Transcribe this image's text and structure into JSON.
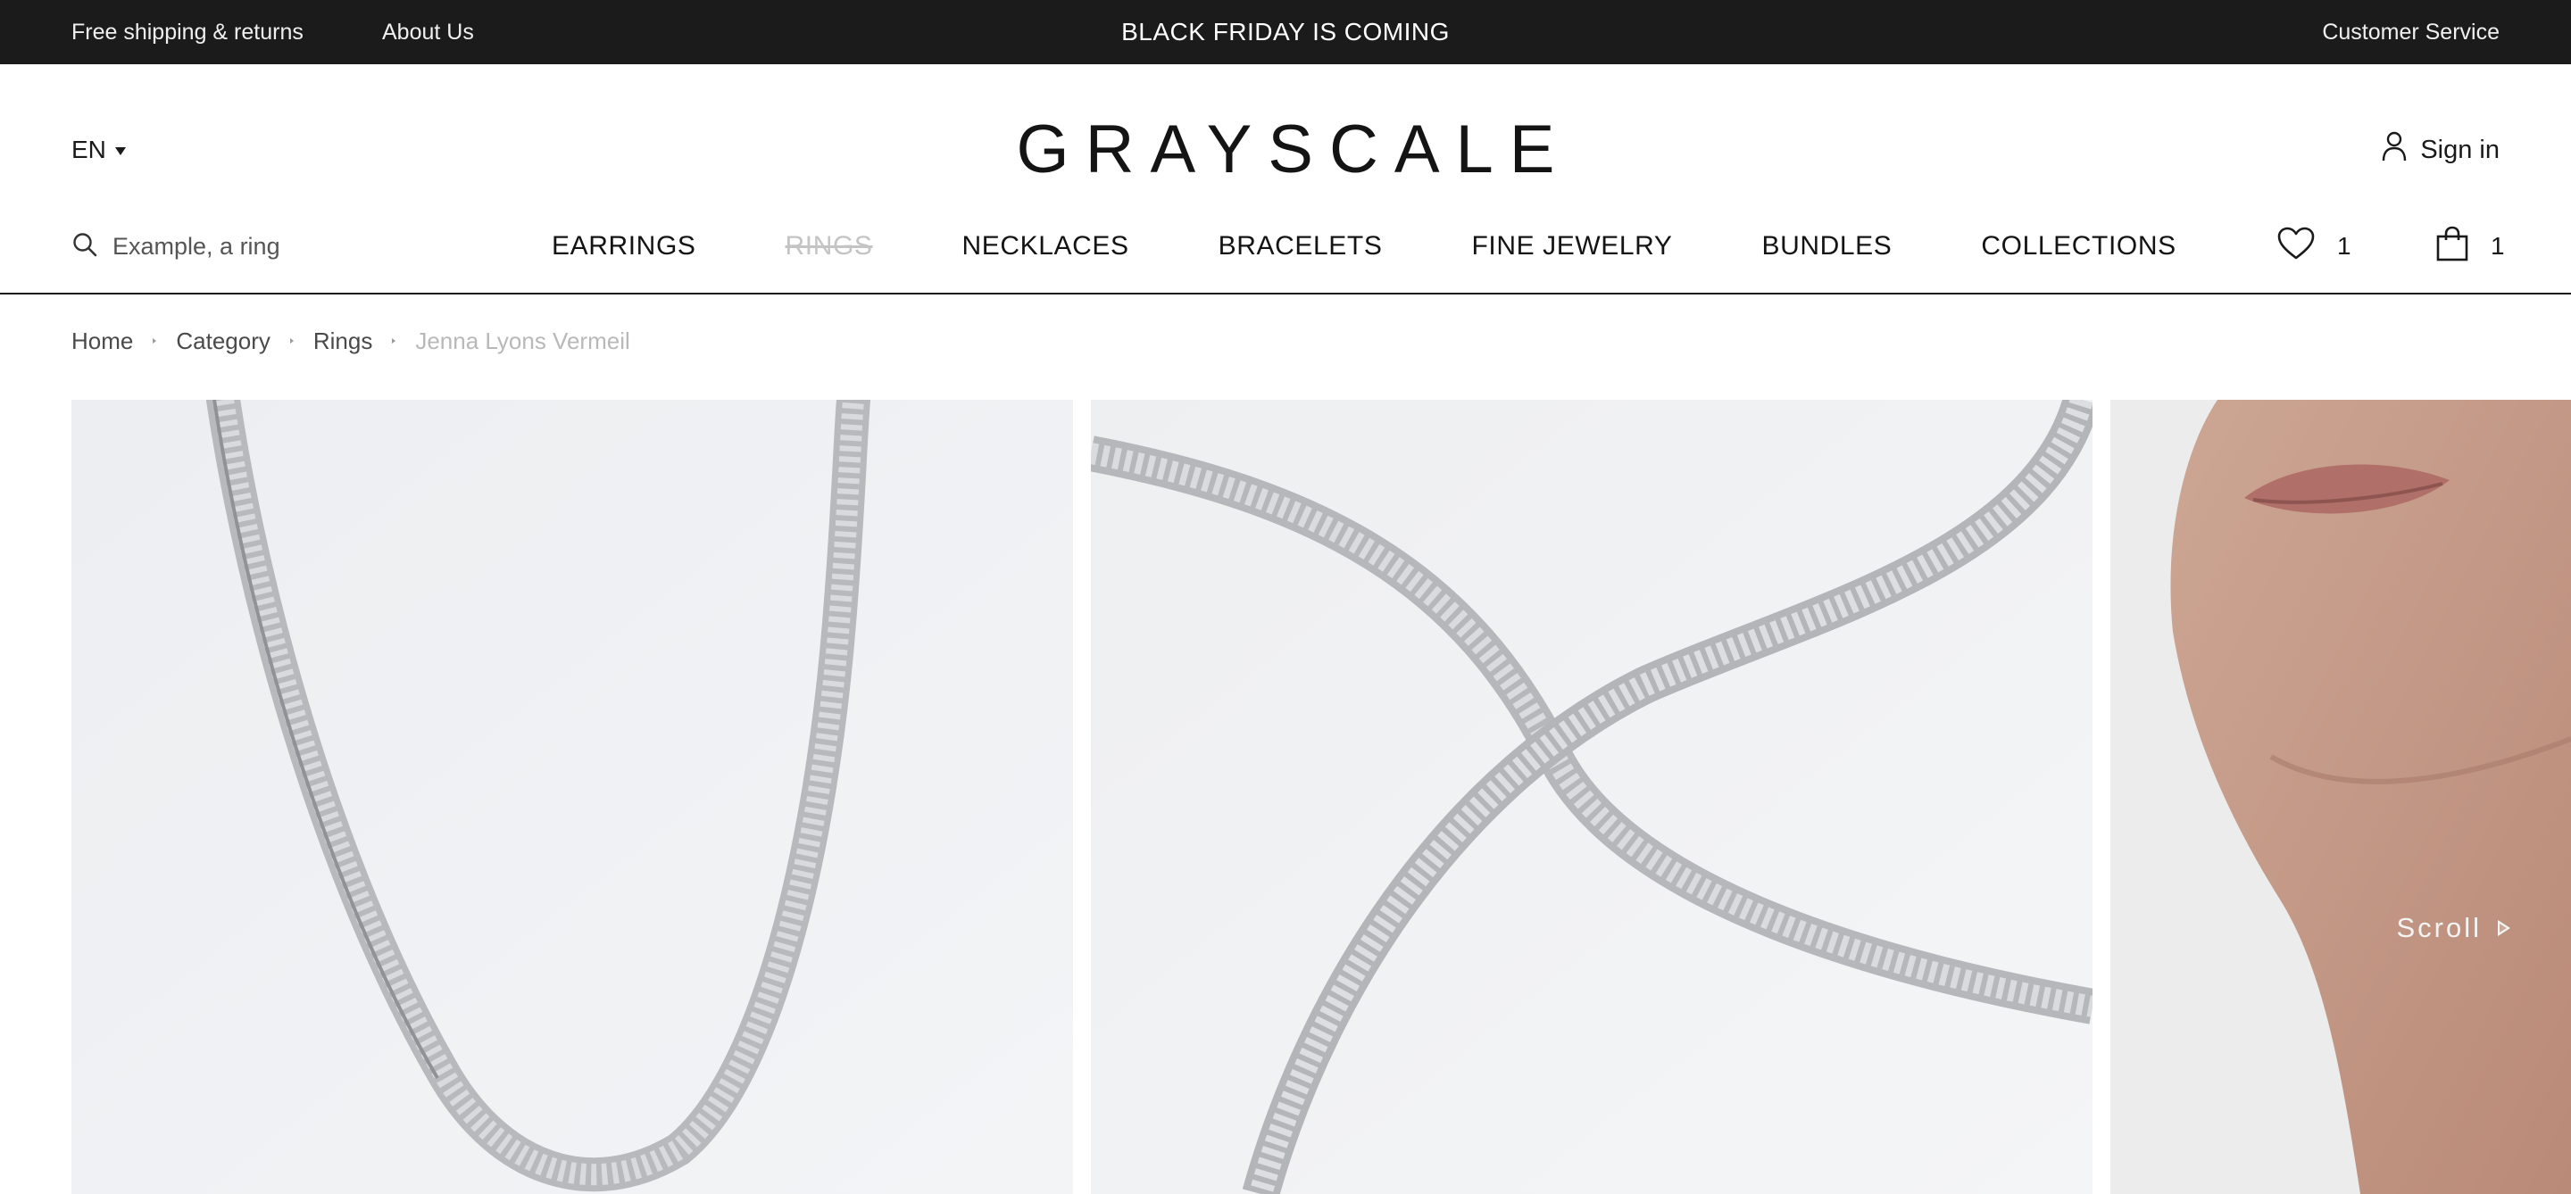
{
  "topbar": {
    "shipping_link": "Free shipping & returns",
    "about_link": "About Us",
    "promo": "BLACK FRIDAY IS COMING",
    "service_link": "Customer Service"
  },
  "header": {
    "language": "EN",
    "logo": "GRAYSCALE",
    "signin_label": "Sign in"
  },
  "search": {
    "placeholder": "Example, a ring"
  },
  "nav": {
    "items": [
      {
        "label": "EARRINGS"
      },
      {
        "label": "RINGS"
      },
      {
        "label": "NECKLACES"
      },
      {
        "label": "BRACELETS"
      },
      {
        "label": "FINE JEWELRY"
      },
      {
        "label": "BUNDLES"
      },
      {
        "label": "COLLECTIONS"
      }
    ]
  },
  "utility": {
    "wishlist_count": "1",
    "cart_count": "1"
  },
  "breadcrumb": {
    "items": [
      "Home",
      "Category",
      "Rings"
    ],
    "current": "Jenna Lyons Vermeil"
  },
  "gallery": {
    "scroll_label": "Scroll"
  },
  "colors": {
    "topbar_bg": "#1b1b1b",
    "text": "#1a1a1a",
    "muted": "#b8b8b8",
    "photo_bg": "#eff0f2"
  }
}
